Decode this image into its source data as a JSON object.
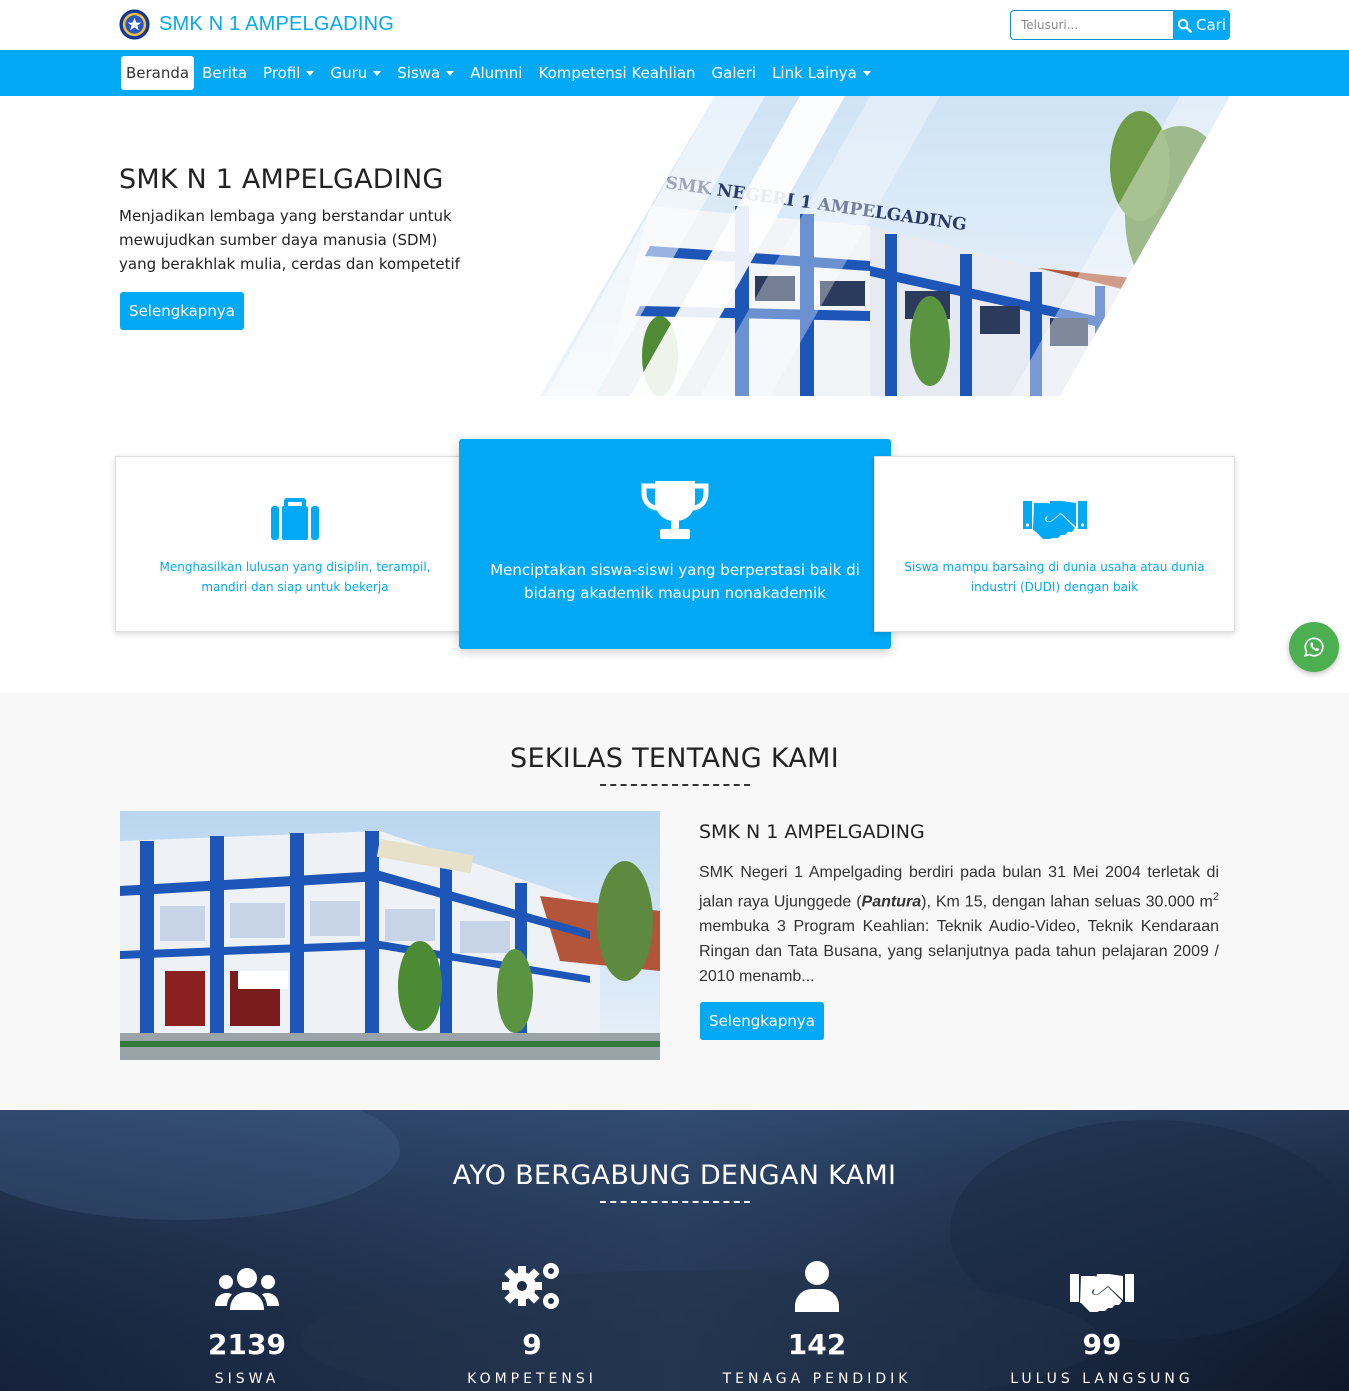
{
  "brand": {
    "name": "SMK N 1 AMPELGADING",
    "logo_icon": "school-emblem-icon"
  },
  "search": {
    "placeholder": "Telusuri...",
    "button_label": "Cari"
  },
  "nav": {
    "items": [
      {
        "label": "Beranda",
        "active": true,
        "dropdown": false
      },
      {
        "label": "Berita",
        "active": false,
        "dropdown": false
      },
      {
        "label": "Profil",
        "active": false,
        "dropdown": true
      },
      {
        "label": "Guru",
        "active": false,
        "dropdown": true
      },
      {
        "label": "Siswa",
        "active": false,
        "dropdown": true
      },
      {
        "label": "Alumni",
        "active": false,
        "dropdown": false
      },
      {
        "label": "Kompetensi Keahlian",
        "active": false,
        "dropdown": false
      },
      {
        "label": "Galeri",
        "active": false,
        "dropdown": false
      },
      {
        "label": "Link Lainya",
        "active": false,
        "dropdown": true
      }
    ]
  },
  "hero": {
    "title": "SMK N 1 AMPELGADING",
    "text": "Menjadikan lembaga yang berstandar untuk mewujudkan sumber daya manusia (SDM) yang berakhlak mulia, cerdas dan kompetetif",
    "button_label": "Selengkapnya",
    "image_sign": "SMK NEGERI 1 AMPELGADING"
  },
  "features": [
    {
      "icon": "briefcase-icon",
      "text": "Menghasilkan lulusan yang disiplin, terampil, mandiri dan siap untuk bekerja"
    },
    {
      "icon": "trophy-icon",
      "text": "Menciptakan siswa-siswi yang berperstasi baik di bidang akademik maupun nonakademik"
    },
    {
      "icon": "handshake-icon",
      "text": "Siswa mampu barsaing di dunia usaha atau dunia industri (DUDI) dengan baik"
    }
  ],
  "about": {
    "section_title": "SEKILAS TENTANG KAMI",
    "subtitle": "SMK N 1 AMPELGADING",
    "text_part1": "SMK Negeri 1 Ampelgading berdiri pada bulan 31 Mei 2004 terletak di jalan raya Ujunggede (",
    "text_emphasis": "Pantura",
    "text_part2": "), Km 15,  dengan lahan seluas 30.000 m",
    "text_sup": "2",
    "text_part3": "  membuka 3 Program Keahlian: Teknik Audio-Video, Teknik Kendaraan Ringan dan Tata Busana, yang selanjutnya pada tahun pelajaran 2009 / 2010 menamb...",
    "button_label": "Selengkapnya"
  },
  "join": {
    "section_title": "AYO BERGABUNG DENGAN KAMI",
    "stats": [
      {
        "icon": "users-icon",
        "value": "2139",
        "label": "SISWA"
      },
      {
        "icon": "gears-icon",
        "value": "9",
        "label": "KOMPETENSI"
      },
      {
        "icon": "user-icon",
        "value": "142",
        "label": "TENAGA PENDIDIK"
      },
      {
        "icon": "handshake-icon",
        "value": "99",
        "label": "LULUS LANGSUNG"
      }
    ]
  },
  "whatsapp": {
    "icon": "whatsapp-icon"
  },
  "colors": {
    "primary": "#03a9f4",
    "whatsapp": "#4caf50",
    "background_alt": "#f8f8f8",
    "join_overlay": "#1c2a44"
  }
}
